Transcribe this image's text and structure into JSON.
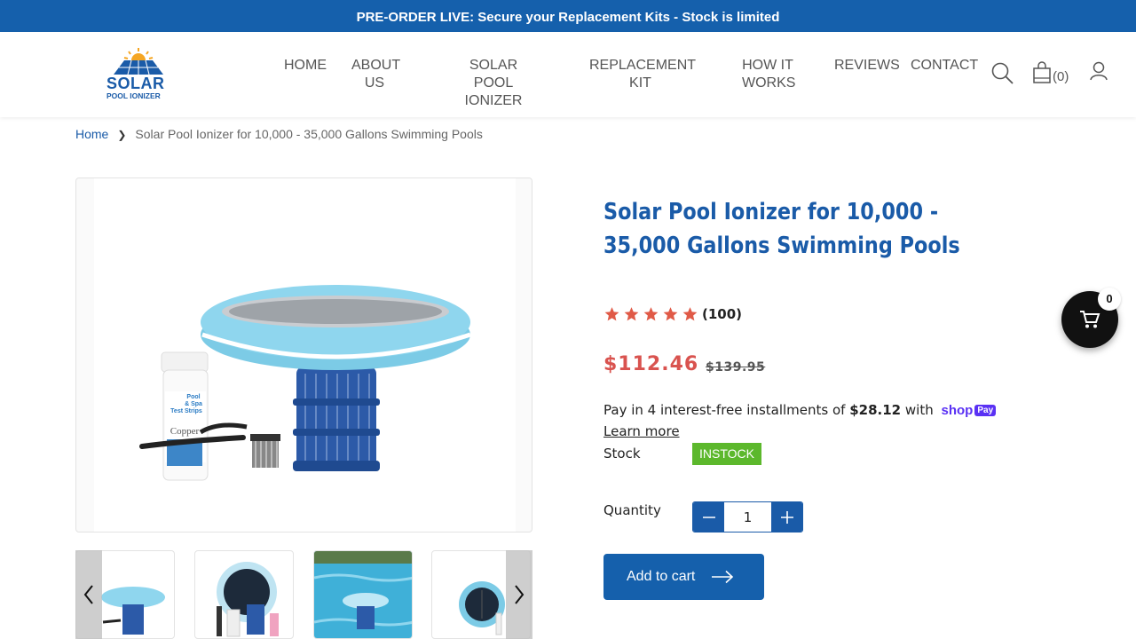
{
  "announcement": "PRE-ORDER LIVE: Secure your Replacement Kits - Stock is limited",
  "logo": {
    "word": "SOLAR",
    "sub": "POOL IONIZER"
  },
  "nav": {
    "home": "HOME",
    "about": [
      "ABOUT",
      "US"
    ],
    "ionizer": [
      "SOLAR POOL",
      "IONIZER"
    ],
    "kit": [
      "REPLACEMENT",
      "KIT"
    ],
    "how": [
      "HOW IT",
      "WORKS"
    ],
    "reviews": "REVIEWS",
    "contact": "CONTACT"
  },
  "header_icons": {
    "search": "search-icon",
    "cart": "shopping-bag-icon",
    "account": "user-icon"
  },
  "cart_count": "(0)",
  "breadcrumb": {
    "home": "Home",
    "current": "Solar Pool Ionizer for 10,000 - 35,000 Gallons Swimming Pools"
  },
  "product": {
    "title": "Solar Pool Ionizer for 10,000 - 35,000 Gallons Swimming Pools",
    "rating": 5,
    "review_count": "(100)",
    "price": "$112.46",
    "compare_price": "$139.95",
    "installments_prefix": "Pay in 4 interest-free installments of",
    "installment_amount": "$28.12",
    "installments_suffix": "with",
    "shoppay_word": "shop",
    "shoppay_badge": "Pay",
    "learn_more": "Learn more",
    "stock_label": "Stock",
    "stock_status": "INSTOCK",
    "quantity_label": "Quantity",
    "quantity_value": "1",
    "add_to_cart": "Add to cart",
    "strip_label": [
      "Pool",
      "& Spa",
      "Test Strips"
    ],
    "strip_brand": "Copper"
  },
  "floating_cart_count": "0",
  "colors": {
    "brand_blue": "#1560ac",
    "price_red": "#d9534f",
    "instock_green": "#5cb82c",
    "shoppay_purple": "#5a31f4"
  }
}
